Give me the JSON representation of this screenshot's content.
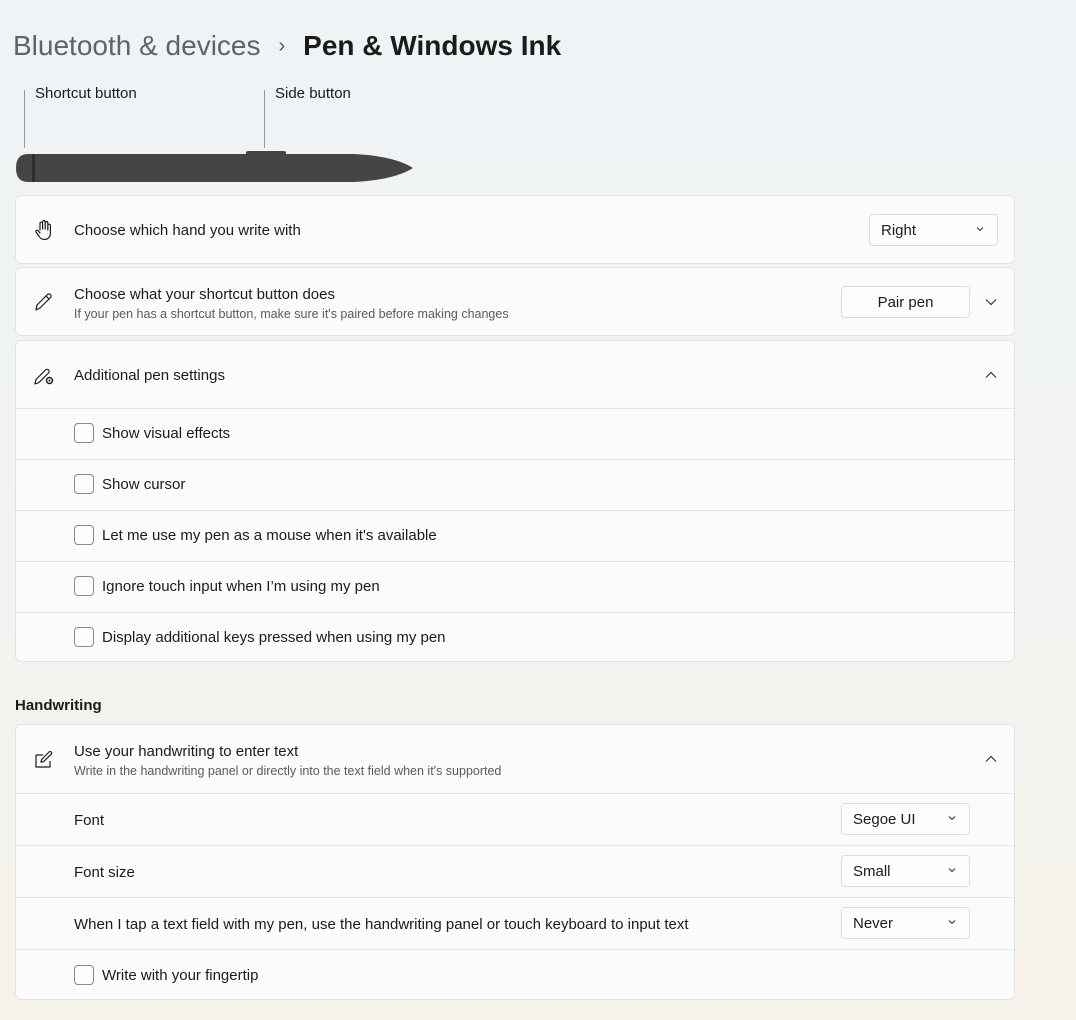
{
  "breadcrumb": {
    "parent": "Bluetooth & devices",
    "separator": "›",
    "current": "Pen & Windows Ink"
  },
  "pen_diagram": {
    "shortcut_label": "Shortcut button",
    "side_label": "Side button"
  },
  "hand_setting": {
    "icon": "hand-icon",
    "title": "Choose which hand you write with",
    "value": "Right"
  },
  "shortcut_setting": {
    "icon": "pen-icon",
    "title": "Choose what your shortcut button does",
    "subtitle": "If your pen has a shortcut button, make sure it's paired before making changes",
    "button_label": "Pair pen"
  },
  "additional_settings": {
    "icon": "pen-settings-icon",
    "title": "Additional pen settings",
    "options": [
      {
        "label": "Show visual effects",
        "checked": false
      },
      {
        "label": "Show cursor",
        "checked": false
      },
      {
        "label": "Let me use my pen as a mouse when it's available",
        "checked": false
      },
      {
        "label": "Ignore touch input when I’m using my pen",
        "checked": false
      },
      {
        "label": "Display additional keys pressed when using my pen",
        "checked": false
      }
    ]
  },
  "handwriting": {
    "section_title": "Handwriting",
    "icon": "handwriting-icon",
    "title": "Use your handwriting to enter text",
    "subtitle": "Write in the handwriting panel or directly into the text field when it's supported",
    "font_label": "Font",
    "font_value": "Segoe UI",
    "font_size_label": "Font size",
    "font_size_value": "Small",
    "tap_label": "When I tap a text field with my pen, use the handwriting panel or touch keyboard to input text",
    "tap_value": "Never",
    "fingertip_label": "Write with your fingertip",
    "fingertip_checked": false
  }
}
